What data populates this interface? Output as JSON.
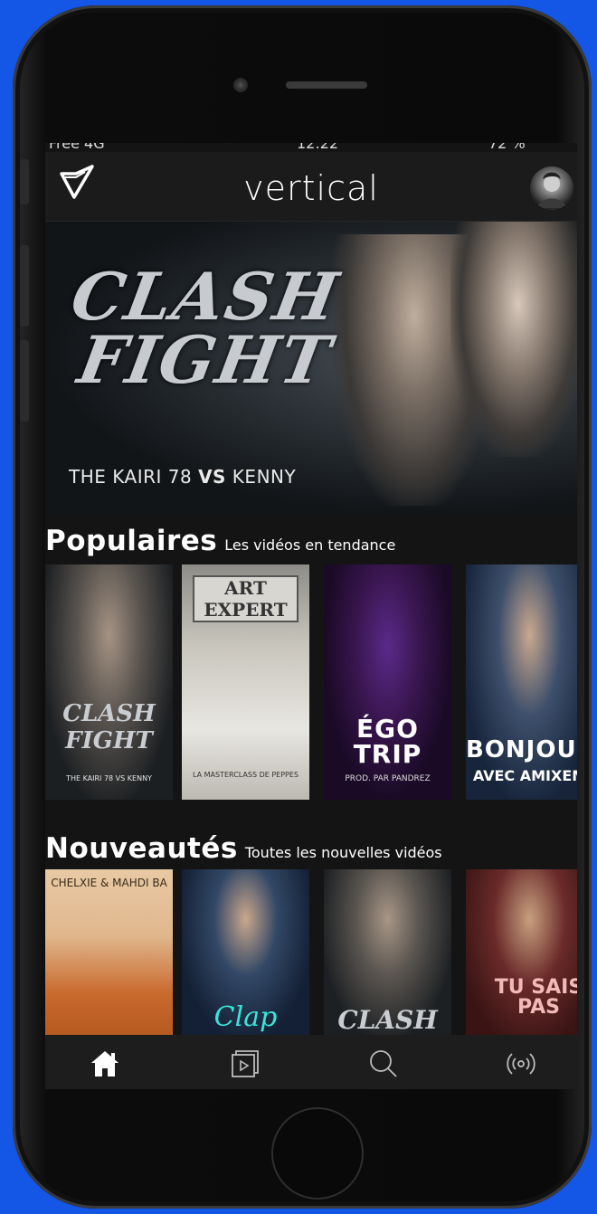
{
  "app": {
    "title": "vertical",
    "status": {
      "carrier": "Free 4G",
      "time": "12:22",
      "battery": "72 %"
    }
  },
  "hero": {
    "title_line1": "CLASH",
    "title_line2": "FIGHT",
    "subtitle_a": "THE KAIRI 78 ",
    "subtitle_vs": "VS",
    "subtitle_b": " KENNY"
  },
  "sections": [
    {
      "title": "Populaires",
      "subtitle": "Les vidéos en tendance",
      "cards": [
        {
          "caption": "CLASH FIGHT",
          "small": "THE KAIRI 78 VS KENNY",
          "icon": "clash-fight-poster"
        },
        {
          "caption": "ART EXPERT",
          "small": "LA MASTERCLASS DE PEPPES",
          "icon": "art-expert-poster"
        },
        {
          "caption": "ÉGO TRIP",
          "small": "PROD. PAR PANDREZ",
          "icon": "ego-trip-poster"
        },
        {
          "caption": "BONJOUR",
          "small": "AVEC AMIXEM",
          "icon": "bonjour-poster"
        }
      ]
    },
    {
      "title": "Nouveautés",
      "subtitle": "Toutes les nouvelles vidéos",
      "cards": [
        {
          "caption": "CHELXIE & MAHDI BA",
          "icon": "chelxie-mahdi-poster"
        },
        {
          "caption": "Clap",
          "icon": "clap-poster"
        },
        {
          "caption": "CLASH",
          "icon": "clash-poster"
        },
        {
          "caption": "TU SAIS PAS",
          "icon": "tu-sais-pas-poster"
        }
      ]
    }
  ],
  "tabs": [
    {
      "name": "home",
      "icon": "home-icon",
      "active": true
    },
    {
      "name": "videos",
      "icon": "play-icon",
      "active": false
    },
    {
      "name": "search",
      "icon": "search-icon",
      "active": false
    },
    {
      "name": "live",
      "icon": "broadcast-icon",
      "active": false
    }
  ],
  "colors": {
    "background": "#141414",
    "appbar": "#1b1b1b",
    "device_backdrop": "#1456e6",
    "text": "#ffffff"
  }
}
